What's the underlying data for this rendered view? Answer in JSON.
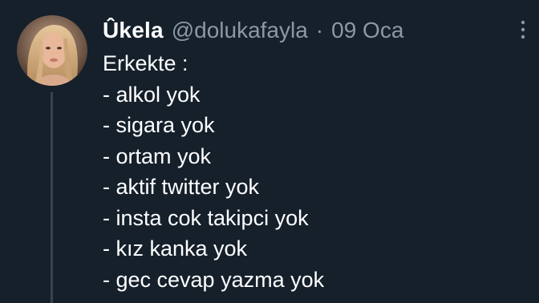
{
  "tweet": {
    "display_name": "Ûkela",
    "handle": "@dolukafayla",
    "separator": "·",
    "date": "09 Oca",
    "lines": [
      "Erkekte :",
      "- alkol yok",
      "- sigara yok",
      "- ortam yok",
      "- aktif twitter yok",
      "- insta cok takipci yok",
      "- kız kanka yok",
      "- gec cevap yazma yok"
    ]
  },
  "icons": {
    "more": "more-vertical-icon",
    "avatar": "profile-photo"
  },
  "colors": {
    "background": "#15202b",
    "text": "#ffffff",
    "secondary_text": "#8b98a5",
    "thread_line": "#38444d"
  }
}
